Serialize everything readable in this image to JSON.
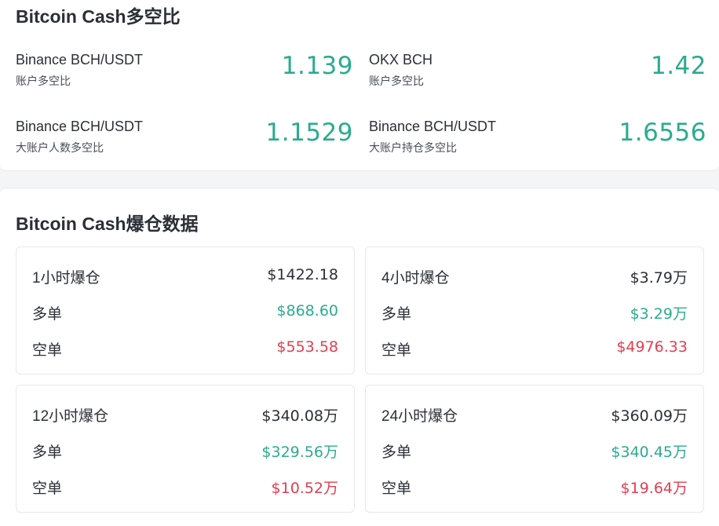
{
  "ratio_section": {
    "title": "Bitcoin Cash多空比",
    "items": [
      {
        "name": "Binance BCH/USDT",
        "sub": "账户多空比",
        "value": "1.139"
      },
      {
        "name": "OKX BCH",
        "sub": "账户多空比",
        "value": "1.42"
      },
      {
        "name": "Binance BCH/USDT",
        "sub": "大账户人数多空比",
        "value": "1.1529"
      },
      {
        "name": "Binance BCH/USDT",
        "sub": "大账户持仓多空比",
        "value": "1.6556"
      }
    ]
  },
  "liquidation_section": {
    "title": "Bitcoin Cash爆仓数据",
    "long_label": "多单",
    "short_label": "空单",
    "boxes": [
      {
        "period": "1小时爆仓",
        "total": "$1422.18",
        "long": "$868.60",
        "short": "$553.58"
      },
      {
        "period": "4小时爆仓",
        "total": "$3.79万",
        "long": "$3.29万",
        "short": "$4976.33"
      },
      {
        "period": "12小时爆仓",
        "total": "$340.08万",
        "long": "$329.56万",
        "short": "$10.52万"
      },
      {
        "period": "24小时爆仓",
        "total": "$360.09万",
        "long": "$340.45万",
        "short": "$19.64万"
      }
    ]
  },
  "colors": {
    "long_green": "#2cab8f",
    "short_red": "#e33e51",
    "text_dark": "#2b2f36"
  }
}
